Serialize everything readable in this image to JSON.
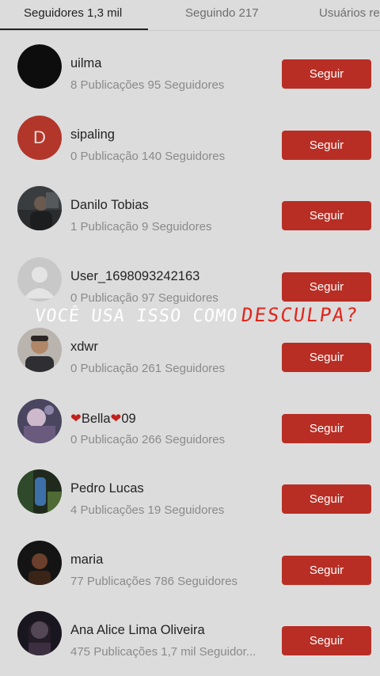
{
  "tabs": [
    {
      "label": "Seguidores 1,3 mil",
      "active": true
    },
    {
      "label": "Seguindo 217",
      "active": false
    },
    {
      "label": "Usuários re",
      "active": false
    }
  ],
  "follow_label": "Seguir",
  "users": [
    {
      "name": "uilma",
      "meta": "8 Publicações 95 Seguidores",
      "avatar": "dark-avatar"
    },
    {
      "name": "sipaling",
      "meta": "0 Publicação 140 Seguidores",
      "avatar": "letter-avatar",
      "initial": "D"
    },
    {
      "name": "Danilo Tobias",
      "meta": "1 Publicação 9 Seguidores",
      "avatar": "photo-avatar"
    },
    {
      "name": "User_1698093242163",
      "meta": "0 Publicação 97 Seguidores",
      "avatar": "default-avatar"
    },
    {
      "name": "xdwr",
      "meta": "0 Publicação 261 Seguidores",
      "avatar": "photo-avatar"
    },
    {
      "name_prefix": "❤",
      "name_mid": "Bella",
      "name_heart2": "❤",
      "name_suffix": "09",
      "meta": "0 Publicação 266 Seguidores",
      "avatar": "photo-avatar"
    },
    {
      "name": "Pedro Lucas",
      "meta": "4 Publicações 19 Seguidores",
      "avatar": "photo-avatar"
    },
    {
      "name": "maria",
      "meta": "77 Publicações 786 Seguidores",
      "avatar": "photo-avatar"
    },
    {
      "name": "Ana Alice Lima Oliveira",
      "meta": "475 Publicações 1,7 mil Seguidor...",
      "avatar": "photo-avatar"
    }
  ],
  "overlay": {
    "caption_white": "VOCÊ USA ISSO COMO",
    "caption_red": "DESCULPA?"
  },
  "colors": {
    "accent": "#b82e24",
    "background": "#dcdcdc",
    "caption_red": "#e0261c"
  }
}
